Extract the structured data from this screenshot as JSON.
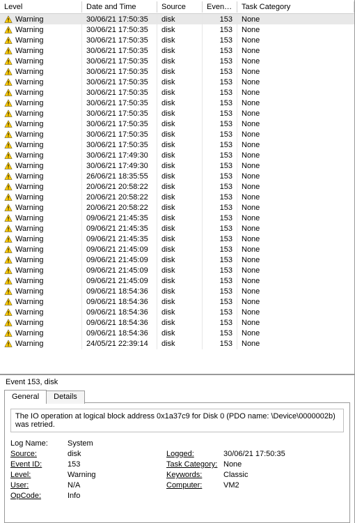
{
  "columns": {
    "level": "Level",
    "date": "Date and Time",
    "source": "Source",
    "event": "Event ID",
    "task": "Task Category"
  },
  "rows": [
    {
      "level": "Warning",
      "date": "30/06/21 17:50:35",
      "source": "disk",
      "event": "153",
      "task": "None"
    },
    {
      "level": "Warning",
      "date": "30/06/21 17:50:35",
      "source": "disk",
      "event": "153",
      "task": "None"
    },
    {
      "level": "Warning",
      "date": "30/06/21 17:50:35",
      "source": "disk",
      "event": "153",
      "task": "None"
    },
    {
      "level": "Warning",
      "date": "30/06/21 17:50:35",
      "source": "disk",
      "event": "153",
      "task": "None"
    },
    {
      "level": "Warning",
      "date": "30/06/21 17:50:35",
      "source": "disk",
      "event": "153",
      "task": "None"
    },
    {
      "level": "Warning",
      "date": "30/06/21 17:50:35",
      "source": "disk",
      "event": "153",
      "task": "None"
    },
    {
      "level": "Warning",
      "date": "30/06/21 17:50:35",
      "source": "disk",
      "event": "153",
      "task": "None"
    },
    {
      "level": "Warning",
      "date": "30/06/21 17:50:35",
      "source": "disk",
      "event": "153",
      "task": "None"
    },
    {
      "level": "Warning",
      "date": "30/06/21 17:50:35",
      "source": "disk",
      "event": "153",
      "task": "None"
    },
    {
      "level": "Warning",
      "date": "30/06/21 17:50:35",
      "source": "disk",
      "event": "153",
      "task": "None"
    },
    {
      "level": "Warning",
      "date": "30/06/21 17:50:35",
      "source": "disk",
      "event": "153",
      "task": "None"
    },
    {
      "level": "Warning",
      "date": "30/06/21 17:50:35",
      "source": "disk",
      "event": "153",
      "task": "None"
    },
    {
      "level": "Warning",
      "date": "30/06/21 17:50:35",
      "source": "disk",
      "event": "153",
      "task": "None"
    },
    {
      "level": "Warning",
      "date": "30/06/21 17:49:30",
      "source": "disk",
      "event": "153",
      "task": "None"
    },
    {
      "level": "Warning",
      "date": "30/06/21 17:49:30",
      "source": "disk",
      "event": "153",
      "task": "None"
    },
    {
      "level": "Warning",
      "date": "26/06/21 18:35:55",
      "source": "disk",
      "event": "153",
      "task": "None"
    },
    {
      "level": "Warning",
      "date": "20/06/21 20:58:22",
      "source": "disk",
      "event": "153",
      "task": "None"
    },
    {
      "level": "Warning",
      "date": "20/06/21 20:58:22",
      "source": "disk",
      "event": "153",
      "task": "None"
    },
    {
      "level": "Warning",
      "date": "20/06/21 20:58:22",
      "source": "disk",
      "event": "153",
      "task": "None"
    },
    {
      "level": "Warning",
      "date": "09/06/21 21:45:35",
      "source": "disk",
      "event": "153",
      "task": "None"
    },
    {
      "level": "Warning",
      "date": "09/06/21 21:45:35",
      "source": "disk",
      "event": "153",
      "task": "None"
    },
    {
      "level": "Warning",
      "date": "09/06/21 21:45:35",
      "source": "disk",
      "event": "153",
      "task": "None"
    },
    {
      "level": "Warning",
      "date": "09/06/21 21:45:09",
      "source": "disk",
      "event": "153",
      "task": "None"
    },
    {
      "level": "Warning",
      "date": "09/06/21 21:45:09",
      "source": "disk",
      "event": "153",
      "task": "None"
    },
    {
      "level": "Warning",
      "date": "09/06/21 21:45:09",
      "source": "disk",
      "event": "153",
      "task": "None"
    },
    {
      "level": "Warning",
      "date": "09/06/21 21:45:09",
      "source": "disk",
      "event": "153",
      "task": "None"
    },
    {
      "level": "Warning",
      "date": "09/06/21 18:54:36",
      "source": "disk",
      "event": "153",
      "task": "None"
    },
    {
      "level": "Warning",
      "date": "09/06/21 18:54:36",
      "source": "disk",
      "event": "153",
      "task": "None"
    },
    {
      "level": "Warning",
      "date": "09/06/21 18:54:36",
      "source": "disk",
      "event": "153",
      "task": "None"
    },
    {
      "level": "Warning",
      "date": "09/06/21 18:54:36",
      "source": "disk",
      "event": "153",
      "task": "None"
    },
    {
      "level": "Warning",
      "date": "09/06/21 18:54:36",
      "source": "disk",
      "event": "153",
      "task": "None"
    },
    {
      "level": "Warning",
      "date": "24/05/21 22:39:14",
      "source": "disk",
      "event": "153",
      "task": "None"
    }
  ],
  "detail": {
    "title": "Event 153, disk",
    "tabs": {
      "general": "General",
      "details": "Details"
    },
    "description": "The IO operation at logical block address 0x1a37c9 for Disk 0 (PDO name: \\Device\\0000002b) was retried.",
    "props": {
      "log_name_label": "Log Name:",
      "log_name": "System",
      "source_label": "Source:",
      "source": "disk",
      "logged_label": "Logged:",
      "logged": "30/06/21 17:50:35",
      "event_id_label": "Event ID:",
      "event_id": "153",
      "task_cat_label": "Task Category:",
      "task_cat": "None",
      "level_label": "Level:",
      "level": "Warning",
      "keywords_label": "Keywords:",
      "keywords": "Classic",
      "user_label": "User:",
      "user": "N/A",
      "computer_label": "Computer:",
      "computer": "VM2",
      "opcode_label": "OpCode:",
      "opcode": "Info"
    }
  }
}
